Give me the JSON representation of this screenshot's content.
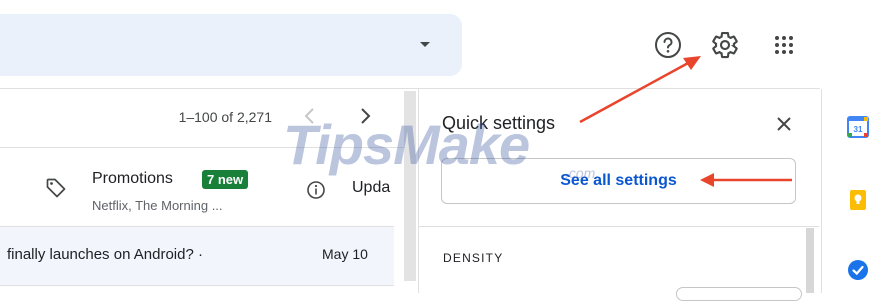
{
  "header": {
    "help_icon": "help-circle-icon",
    "settings_icon": "gear-icon",
    "apps_icon": "apps-grid-icon"
  },
  "mail_list": {
    "pagination": "1–100 of 2,271",
    "tabs": [
      {
        "label": "Promotions",
        "badge": "7 new",
        "preview": "Netflix, The Morning ..."
      },
      {
        "label": "Upda"
      }
    ],
    "rows": [
      {
        "subject": "finally launches on Android? ·",
        "date": "May 10"
      }
    ]
  },
  "quick_settings": {
    "title": "Quick settings",
    "see_all_label": "See all settings",
    "section_density": "DENSITY"
  },
  "side_panel": {
    "calendar_day": "31"
  },
  "watermark": {
    "text": "TipsMake",
    "suffix": ".com"
  },
  "colors": {
    "accent_link": "#0b57d0",
    "badge_green": "#188038",
    "annotation_red": "#e8452c",
    "search_bg": "#eaf1fb"
  }
}
